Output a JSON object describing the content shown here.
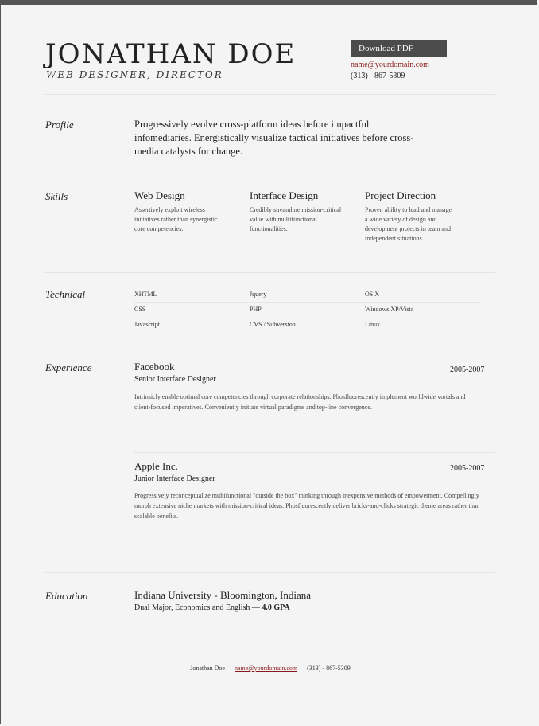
{
  "header": {
    "name": "JONATHAN DOE",
    "role": "WEB DESIGNER, DIRECTOR",
    "download_label": "Download PDF",
    "email": "name@yourdomain.com",
    "phone": "(313) - 867-5309"
  },
  "sections": {
    "profile": "Profile",
    "skills": "Skills",
    "technical": "Technical",
    "experience": "Experience",
    "education": "Education"
  },
  "profile": {
    "text": "Progressively evolve cross-platform ideas before impactful infomediaries. Energistically visualize tactical initiatives before cross-media catalysts for change."
  },
  "skills": [
    {
      "title": "Web Design",
      "desc": "Assertively exploit wireless initiatives rather than synergistic core competencies."
    },
    {
      "title": "Interface Design",
      "desc": "Credibly streamline mission-critical value with multifunctional functionalities."
    },
    {
      "title": "Project Direction",
      "desc": "Proven ability to lead and manage a wide variety of design and development projects in team and independent situations."
    }
  ],
  "technical": [
    [
      "XHTML",
      "Jquery",
      "OS X"
    ],
    [
      "CSS",
      "PHP",
      "Windows XP/Vista"
    ],
    [
      "Javascript",
      "CVS / Subversion",
      "Linux"
    ]
  ],
  "experience": [
    {
      "company": "Facebook",
      "role": "Senior Interface Designer",
      "dates": "2005-2007",
      "desc": "Intrinsicly enable optimal core competencies through corporate relationships. Phosfluorescently implement worldwide vortals and client-focused imperatives. Conveniently initiate virtual paradigms and top-line convergence."
    },
    {
      "company": "Apple Inc.",
      "role": "Junior Interface Designer",
      "dates": "2005-2007",
      "desc": "Progressively reconceptualize multifunctional \"outside the box\" thinking through inexpensive methods of empowerment. Compellingly morph extensive niche markets with mission-critical ideas. Phosfluorescently deliver bricks-and-clicks strategic theme areas rather than scalable benefits."
    }
  ],
  "education": {
    "school": "Indiana University - Bloomington, Indiana",
    "detail": "Dual Major, Economics and English —",
    "gpa": "4.0 GPA"
  },
  "footer": {
    "name": "Jonathan Doe —",
    "email": "name@yourdomain.com",
    "phone": "— (313) - 867-5309"
  },
  "colors": {
    "accent_link": "#8a1a1a",
    "button_bg": "#4b4b4b",
    "frame": "#555555"
  }
}
